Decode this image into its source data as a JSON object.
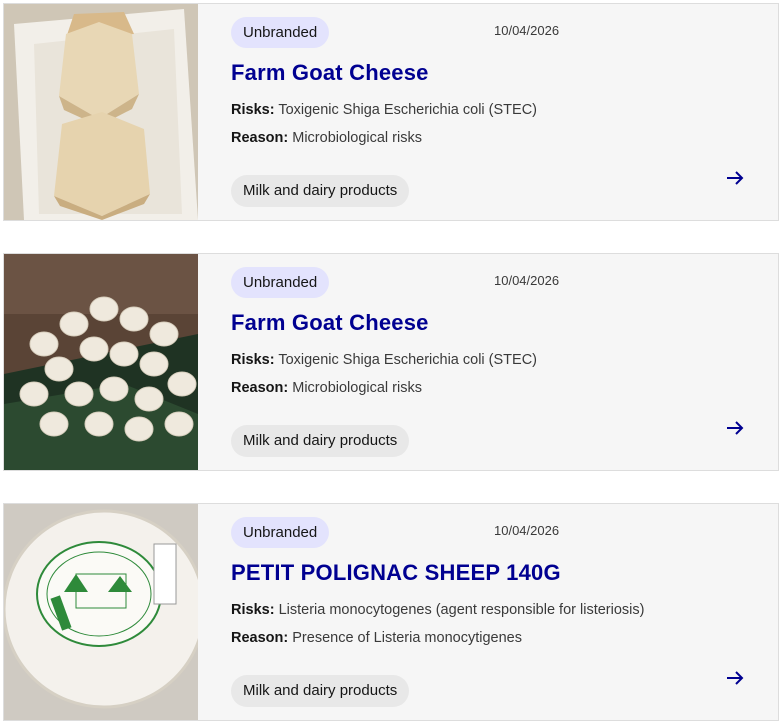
{
  "cards": [
    {
      "badge": "Unbranded",
      "date": "10/04/2026",
      "title": "Farm Goat Cheese",
      "risks_label": "Risks:",
      "risks": "Toxigenic Shiga Escherichia coli (STEC)",
      "reason_label": "Reason:",
      "reason": "Microbiological risks",
      "category": "Milk and dairy products",
      "image": "goat-cheese-pyramids-photo"
    },
    {
      "badge": "Unbranded",
      "date": "10/04/2026",
      "title": "Farm Goat Cheese",
      "risks_label": "Risks:",
      "risks": "Toxigenic Shiga Escherichia coli (STEC)",
      "reason_label": "Reason:",
      "reason": "Microbiological risks",
      "category": "Milk and dairy products",
      "image": "small-goat-cheeses-photo"
    },
    {
      "badge": "Unbranded",
      "date": "10/04/2026",
      "title": "PETIT POLIGNAC SHEEP 140G",
      "risks_label": "Risks:",
      "risks": "Listeria monocytogenes (agent responsible for listeriosis)",
      "reason_label": "Reason:",
      "reason": "Presence of Listeria monocytigenes",
      "category": "Milk and dairy products",
      "image": "sheep-cheese-package-photo"
    }
  ],
  "colors": {
    "title": "#000091",
    "badge_bg": "#e3e3fd",
    "card_bg": "#f6f6f6",
    "tag_bg": "#e8e8e8"
  },
  "icons": {
    "arrow": "arrow-right-icon"
  }
}
